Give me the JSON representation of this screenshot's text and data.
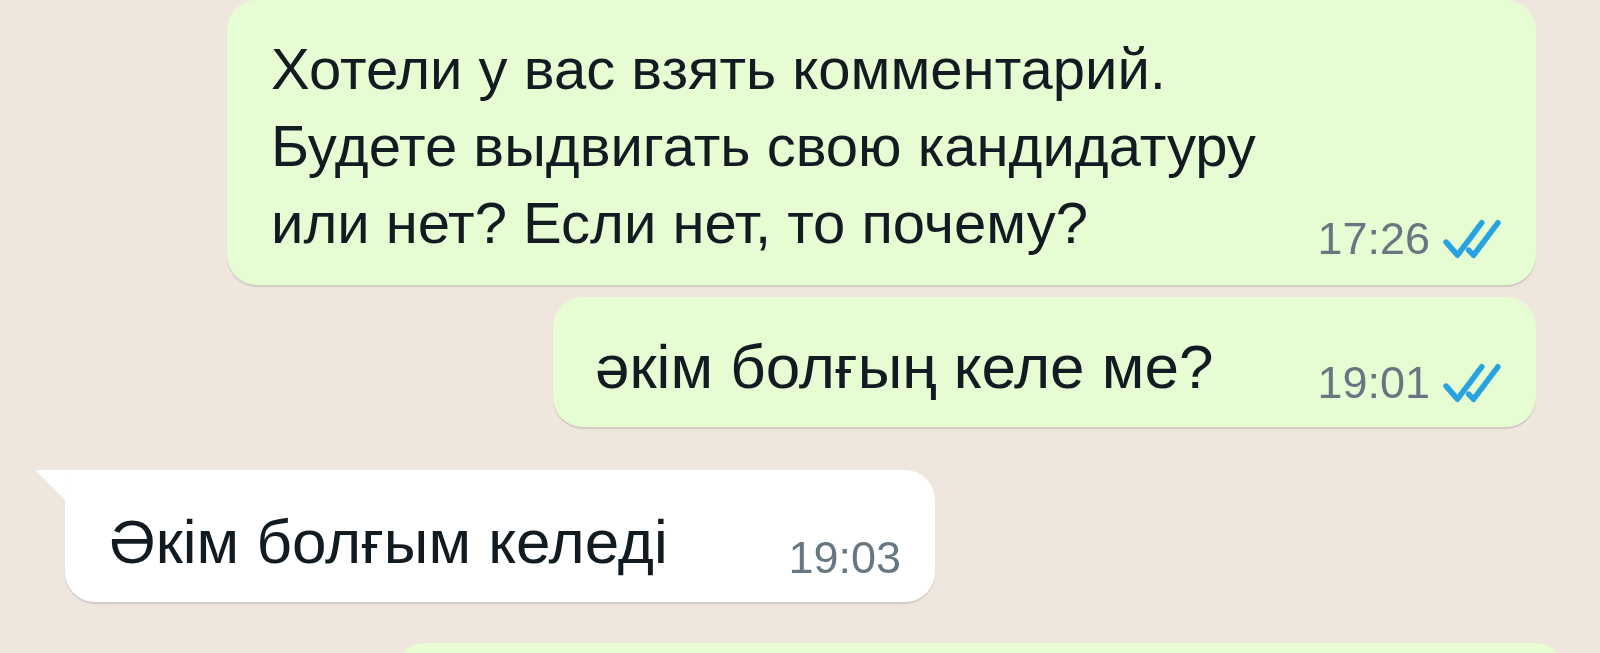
{
  "messages": [
    {
      "kind": "outgoing",
      "text": "Хотели у вас взять комментарий. Будете выдвигать свою кандидатуру или нет? Если нет, то почему?",
      "time": "17:26",
      "read": true
    },
    {
      "kind": "outgoing",
      "text": "әкім болғың келе ме?",
      "time": "19:01",
      "read": true
    },
    {
      "kind": "incoming",
      "text": "Әкім болғым келеді",
      "time": "19:03"
    },
    {
      "kind": "outgoing"
    }
  ]
}
